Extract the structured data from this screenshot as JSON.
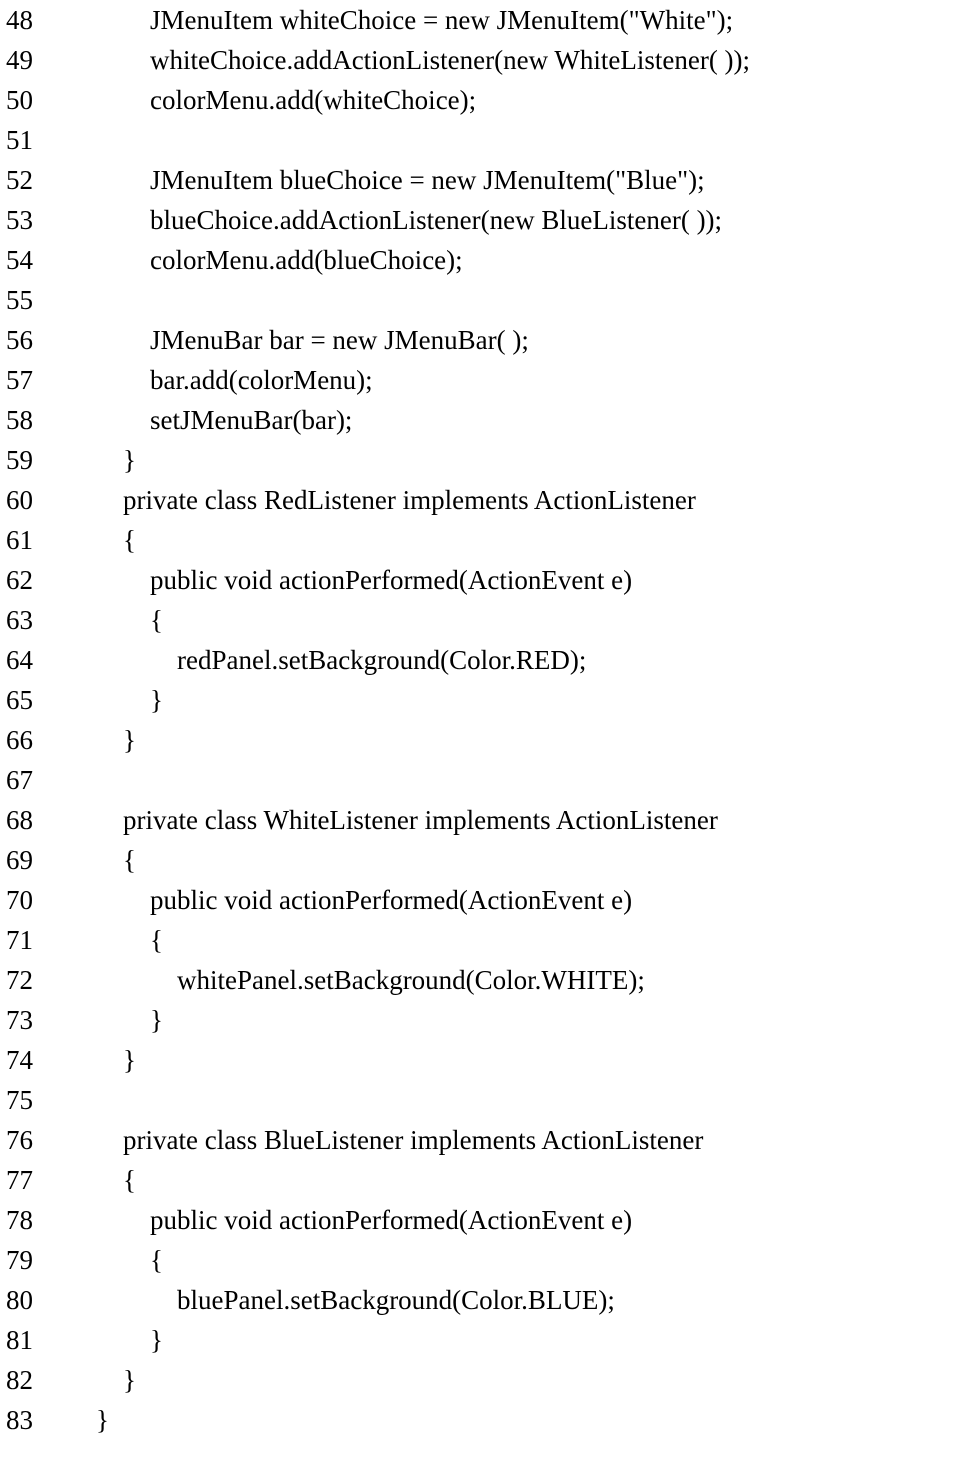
{
  "code": {
    "first_line_number": 48,
    "indent_unit": "    ",
    "lines": [
      {
        "indent": 2,
        "text": "JMenuItem whiteChoice = new JMenuItem(\"White\");"
      },
      {
        "indent": 2,
        "text": "whiteChoice.addActionListener(new WhiteListener( ));"
      },
      {
        "indent": 2,
        "text": "colorMenu.add(whiteChoice);"
      },
      {
        "indent": 2,
        "text": ""
      },
      {
        "indent": 2,
        "text": "JMenuItem blueChoice = new JMenuItem(\"Blue\");"
      },
      {
        "indent": 2,
        "text": "blueChoice.addActionListener(new BlueListener( ));"
      },
      {
        "indent": 2,
        "text": "colorMenu.add(blueChoice);"
      },
      {
        "indent": 2,
        "text": ""
      },
      {
        "indent": 2,
        "text": "JMenuBar bar = new JMenuBar( );"
      },
      {
        "indent": 2,
        "text": "bar.add(colorMenu);"
      },
      {
        "indent": 2,
        "text": "setJMenuBar(bar);"
      },
      {
        "indent": 1,
        "text": "}"
      },
      {
        "indent": 1,
        "text": "private class RedListener implements ActionListener"
      },
      {
        "indent": 1,
        "text": "{"
      },
      {
        "indent": 2,
        "text": "public void actionPerformed(ActionEvent e)"
      },
      {
        "indent": 2,
        "text": "{"
      },
      {
        "indent": 3,
        "text": "redPanel.setBackground(Color.RED);"
      },
      {
        "indent": 2,
        "text": "}"
      },
      {
        "indent": 1,
        "text": "}"
      },
      {
        "indent": 1,
        "text": ""
      },
      {
        "indent": 1,
        "text": "private class WhiteListener implements ActionListener"
      },
      {
        "indent": 1,
        "text": "{"
      },
      {
        "indent": 2,
        "text": "public void actionPerformed(ActionEvent e)"
      },
      {
        "indent": 2,
        "text": "{"
      },
      {
        "indent": 3,
        "text": "whitePanel.setBackground(Color.WHITE);"
      },
      {
        "indent": 2,
        "text": "}"
      },
      {
        "indent": 1,
        "text": "}"
      },
      {
        "indent": 1,
        "text": ""
      },
      {
        "indent": 1,
        "text": "private class BlueListener implements ActionListener"
      },
      {
        "indent": 1,
        "text": "{"
      },
      {
        "indent": 2,
        "text": "public void actionPerformed(ActionEvent e)"
      },
      {
        "indent": 2,
        "text": "{"
      },
      {
        "indent": 3,
        "text": "bluePanel.setBackground(Color.BLUE);"
      },
      {
        "indent": 2,
        "text": "}"
      },
      {
        "indent": 1,
        "text": "}"
      },
      {
        "indent": 0,
        "text": "}"
      }
    ]
  }
}
